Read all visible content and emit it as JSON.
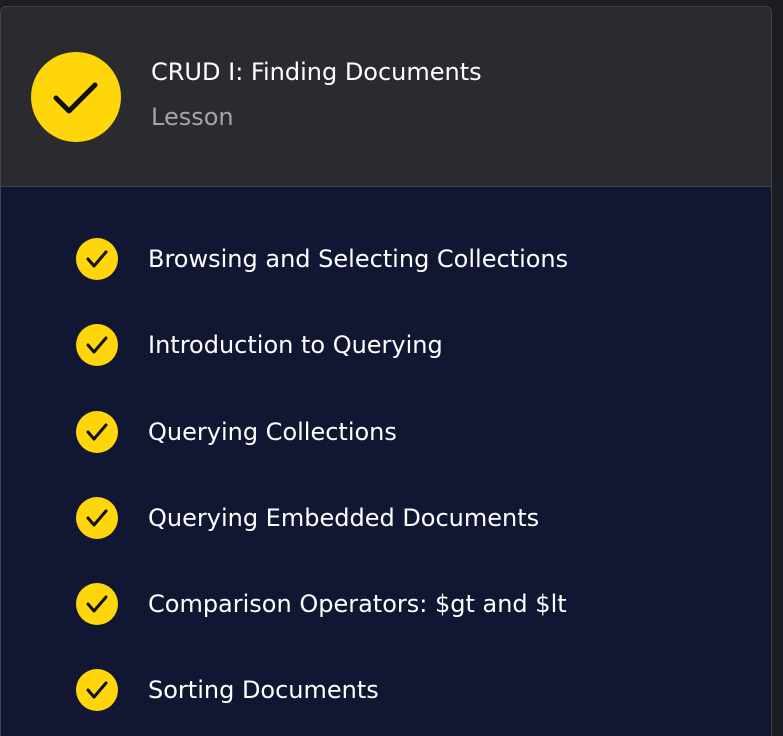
{
  "lesson": {
    "title": "CRUD I: Finding Documents",
    "type_label": "Lesson",
    "status_icon": "check-circle-icon",
    "accent_color": "#ffd60a"
  },
  "items": [
    {
      "label": "Browsing and Selecting Collections",
      "status_icon": "check-circle-icon"
    },
    {
      "label": "Introduction to Querying",
      "status_icon": "check-circle-icon"
    },
    {
      "label": "Querying Collections",
      "status_icon": "check-circle-icon"
    },
    {
      "label": "Querying Embedded Documents",
      "status_icon": "check-circle-icon"
    },
    {
      "label": "Comparison Operators: $gt and $lt",
      "status_icon": "check-circle-icon"
    },
    {
      "label": "Sorting Documents",
      "status_icon": "check-circle-icon"
    }
  ]
}
